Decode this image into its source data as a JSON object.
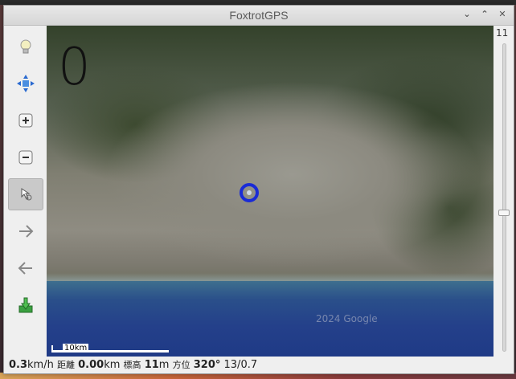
{
  "window": {
    "title": "FoxtrotGPS"
  },
  "titlebar_buttons": [
    "⌄",
    "⌃",
    "✕"
  ],
  "map": {
    "speed_display": "0",
    "copyright": "2024 Google",
    "scale_label": "10km"
  },
  "zoom": {
    "level": "11",
    "slider_fraction": 0.55
  },
  "status": {
    "speed_value": "0.3",
    "speed_unit": "km/h",
    "distance_label": "距離",
    "distance_value": "0.00",
    "distance_unit": "km",
    "altitude_label": "標高",
    "altitude_value": "11",
    "altitude_unit": "m",
    "heading_label": "方位",
    "heading_value": "320°",
    "satellites": "13/0.7"
  },
  "colors": {
    "gps_marker": "#1a2bd6",
    "sea": "#24408a"
  },
  "toolbar_icons": [
    "lightbulb-icon",
    "move-icon",
    "zoom-in-icon",
    "zoom-out-icon",
    "autocenter-icon",
    "forward-arrow-icon",
    "back-arrow-icon",
    "download-icon"
  ]
}
